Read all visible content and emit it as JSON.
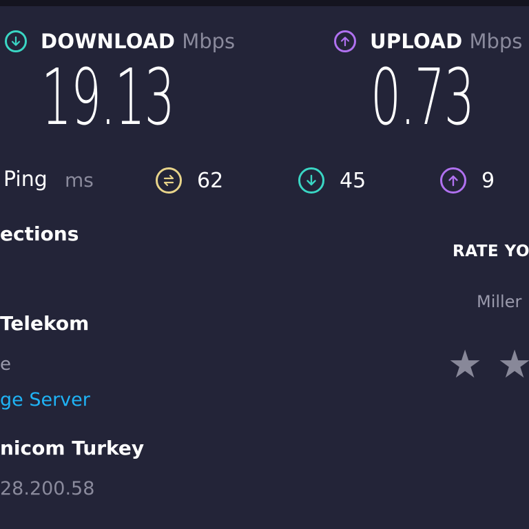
{
  "download": {
    "label": "DOWNLOAD",
    "unit": "Mbps",
    "value": "19.13",
    "color": "#3ad6c4"
  },
  "upload": {
    "label": "UPLOAD",
    "unit": "Mbps",
    "value": "0.73",
    "color": "#b071f0"
  },
  "ping": {
    "label": "Ping",
    "unit": "ms",
    "idle": {
      "value": "62",
      "color": "#e8d48a",
      "icon": "exchange-icon"
    },
    "download": {
      "value": "45",
      "color": "#3ad6c4",
      "icon": "arrow-down-icon"
    },
    "upload": {
      "value": "9",
      "color": "#b071f0",
      "icon": "arrow-up-icon"
    }
  },
  "connections": {
    "title": "ections",
    "isp_name": "Telekom",
    "isp_sub": "e",
    "change_server": "ge Server",
    "server_name": "nicom Turkey",
    "server_ip": "28.200.58"
  },
  "rating": {
    "title": "RATE YO",
    "subtitle": "Miller",
    "stars": [
      "★",
      "★"
    ]
  }
}
